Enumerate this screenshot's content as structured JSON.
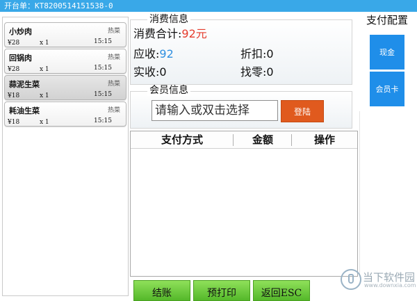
{
  "title": "开台单：KT8200514151538-0",
  "orders": [
    {
      "name": "小炒肉",
      "tag": "热菜",
      "price": "¥28",
      "qty": "x 1",
      "time": "15:15"
    },
    {
      "name": "回锅肉",
      "tag": "热菜",
      "price": "¥28",
      "qty": "x 1",
      "time": "15:15"
    },
    {
      "name": "蒜泥生菜",
      "tag": "热菜",
      "price": "¥18",
      "qty": "x 1",
      "time": "15:15"
    },
    {
      "name": "耗油生菜",
      "tag": "热菜",
      "price": "¥18",
      "qty": "x 1",
      "time": "15:15"
    }
  ],
  "consume": {
    "section_title": "消费信息",
    "total_label": "消费合计:",
    "total_value": "92元",
    "receivable_label": "应收:",
    "receivable_value": "92",
    "discount_label": "折扣:",
    "discount_value": "0",
    "received_label": "实收:",
    "received_value": "0",
    "change_label": "找零:",
    "change_value": "0"
  },
  "member": {
    "section_title": "会员信息",
    "placeholder": "请输入或双击选择",
    "login_label": "登陆"
  },
  "pay_table": {
    "columns": [
      "支付方式",
      "金额",
      "操作"
    ]
  },
  "actions": {
    "checkout": "结账",
    "preprint": "预打印",
    "back": "返回ESC"
  },
  "pay_config": {
    "title": "支付配置",
    "cash": "现金",
    "member_card": "会员卡"
  },
  "watermark": {
    "text": "当下软件园",
    "sub": "www.downxia.com"
  },
  "colors": {
    "titlebar": "#39a8e8",
    "login_button": "#e05a1e",
    "pay_method_button": "#1f8ee9",
    "action_button": "#54b82a",
    "total_value": "#e53b2c",
    "receivable_value": "#2f8fe0"
  },
  "icons": {
    "watermark_logo": "downxia-logo-icon"
  }
}
